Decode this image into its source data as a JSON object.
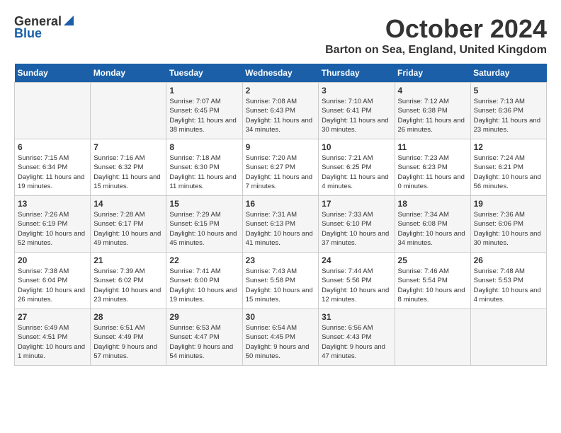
{
  "logo": {
    "general": "General",
    "blue": "Blue"
  },
  "title": "October 2024",
  "location": "Barton on Sea, England, United Kingdom",
  "days_of_week": [
    "Sunday",
    "Monday",
    "Tuesday",
    "Wednesday",
    "Thursday",
    "Friday",
    "Saturday"
  ],
  "weeks": [
    [
      {
        "day": "",
        "info": ""
      },
      {
        "day": "",
        "info": ""
      },
      {
        "day": "1",
        "info": "Sunrise: 7:07 AM\nSunset: 6:45 PM\nDaylight: 11 hours and 38 minutes."
      },
      {
        "day": "2",
        "info": "Sunrise: 7:08 AM\nSunset: 6:43 PM\nDaylight: 11 hours and 34 minutes."
      },
      {
        "day": "3",
        "info": "Sunrise: 7:10 AM\nSunset: 6:41 PM\nDaylight: 11 hours and 30 minutes."
      },
      {
        "day": "4",
        "info": "Sunrise: 7:12 AM\nSunset: 6:38 PM\nDaylight: 11 hours and 26 minutes."
      },
      {
        "day": "5",
        "info": "Sunrise: 7:13 AM\nSunset: 6:36 PM\nDaylight: 11 hours and 23 minutes."
      }
    ],
    [
      {
        "day": "6",
        "info": "Sunrise: 7:15 AM\nSunset: 6:34 PM\nDaylight: 11 hours and 19 minutes."
      },
      {
        "day": "7",
        "info": "Sunrise: 7:16 AM\nSunset: 6:32 PM\nDaylight: 11 hours and 15 minutes."
      },
      {
        "day": "8",
        "info": "Sunrise: 7:18 AM\nSunset: 6:30 PM\nDaylight: 11 hours and 11 minutes."
      },
      {
        "day": "9",
        "info": "Sunrise: 7:20 AM\nSunset: 6:27 PM\nDaylight: 11 hours and 7 minutes."
      },
      {
        "day": "10",
        "info": "Sunrise: 7:21 AM\nSunset: 6:25 PM\nDaylight: 11 hours and 4 minutes."
      },
      {
        "day": "11",
        "info": "Sunrise: 7:23 AM\nSunset: 6:23 PM\nDaylight: 11 hours and 0 minutes."
      },
      {
        "day": "12",
        "info": "Sunrise: 7:24 AM\nSunset: 6:21 PM\nDaylight: 10 hours and 56 minutes."
      }
    ],
    [
      {
        "day": "13",
        "info": "Sunrise: 7:26 AM\nSunset: 6:19 PM\nDaylight: 10 hours and 52 minutes."
      },
      {
        "day": "14",
        "info": "Sunrise: 7:28 AM\nSunset: 6:17 PM\nDaylight: 10 hours and 49 minutes."
      },
      {
        "day": "15",
        "info": "Sunrise: 7:29 AM\nSunset: 6:15 PM\nDaylight: 10 hours and 45 minutes."
      },
      {
        "day": "16",
        "info": "Sunrise: 7:31 AM\nSunset: 6:13 PM\nDaylight: 10 hours and 41 minutes."
      },
      {
        "day": "17",
        "info": "Sunrise: 7:33 AM\nSunset: 6:10 PM\nDaylight: 10 hours and 37 minutes."
      },
      {
        "day": "18",
        "info": "Sunrise: 7:34 AM\nSunset: 6:08 PM\nDaylight: 10 hours and 34 minutes."
      },
      {
        "day": "19",
        "info": "Sunrise: 7:36 AM\nSunset: 6:06 PM\nDaylight: 10 hours and 30 minutes."
      }
    ],
    [
      {
        "day": "20",
        "info": "Sunrise: 7:38 AM\nSunset: 6:04 PM\nDaylight: 10 hours and 26 minutes."
      },
      {
        "day": "21",
        "info": "Sunrise: 7:39 AM\nSunset: 6:02 PM\nDaylight: 10 hours and 23 minutes."
      },
      {
        "day": "22",
        "info": "Sunrise: 7:41 AM\nSunset: 6:00 PM\nDaylight: 10 hours and 19 minutes."
      },
      {
        "day": "23",
        "info": "Sunrise: 7:43 AM\nSunset: 5:58 PM\nDaylight: 10 hours and 15 minutes."
      },
      {
        "day": "24",
        "info": "Sunrise: 7:44 AM\nSunset: 5:56 PM\nDaylight: 10 hours and 12 minutes."
      },
      {
        "day": "25",
        "info": "Sunrise: 7:46 AM\nSunset: 5:54 PM\nDaylight: 10 hours and 8 minutes."
      },
      {
        "day": "26",
        "info": "Sunrise: 7:48 AM\nSunset: 5:53 PM\nDaylight: 10 hours and 4 minutes."
      }
    ],
    [
      {
        "day": "27",
        "info": "Sunrise: 6:49 AM\nSunset: 4:51 PM\nDaylight: 10 hours and 1 minute."
      },
      {
        "day": "28",
        "info": "Sunrise: 6:51 AM\nSunset: 4:49 PM\nDaylight: 9 hours and 57 minutes."
      },
      {
        "day": "29",
        "info": "Sunrise: 6:53 AM\nSunset: 4:47 PM\nDaylight: 9 hours and 54 minutes."
      },
      {
        "day": "30",
        "info": "Sunrise: 6:54 AM\nSunset: 4:45 PM\nDaylight: 9 hours and 50 minutes."
      },
      {
        "day": "31",
        "info": "Sunrise: 6:56 AM\nSunset: 4:43 PM\nDaylight: 9 hours and 47 minutes."
      },
      {
        "day": "",
        "info": ""
      },
      {
        "day": "",
        "info": ""
      }
    ]
  ]
}
